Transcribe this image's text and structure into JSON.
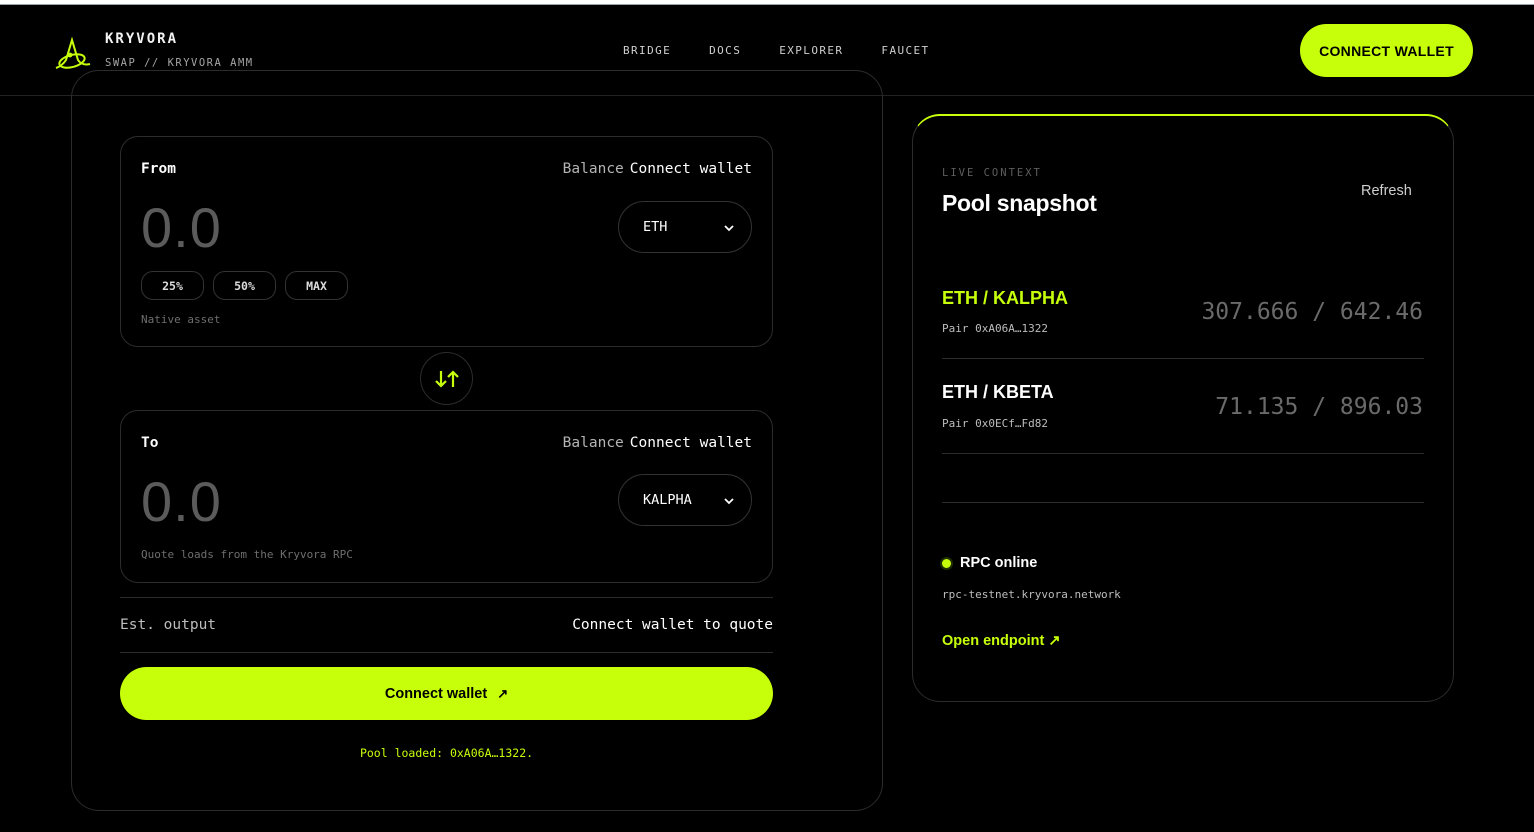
{
  "colors": {
    "accent": "#c7ff0b",
    "background": "#000000",
    "muted": "#5b5b5b"
  },
  "brand": {
    "title": "KRYVORA",
    "subtitle": "SWAP // KRYVORA AMM",
    "logo_icon": "kryvora-logo-icon"
  },
  "nav": {
    "items": [
      "BRIDGE",
      "DOCS",
      "EXPLORER",
      "FAUCET"
    ]
  },
  "header": {
    "connect_label": "CONNECT WALLET"
  },
  "from": {
    "label": "From",
    "balance_label": "Balance",
    "balance_value": "Connect wallet",
    "amount": "0.0",
    "token": "ETH",
    "percent_buttons": [
      "25%",
      "50%",
      "MAX"
    ],
    "hint": "Native asset"
  },
  "to": {
    "label": "To",
    "balance_label": "Balance",
    "balance_value": "Connect wallet",
    "amount": "0.0",
    "token": "KALPHA",
    "hint": "Quote loads from the Kryvora RPC"
  },
  "swap_toggle_icon": "swap-arrows-icon",
  "estimate": {
    "label": "Est. output",
    "value": "Connect wallet to quote"
  },
  "cta": {
    "label": "Connect wallet",
    "arrow": "↗"
  },
  "status_message": "Pool loaded: 0xA06A…1322.",
  "pool_panel": {
    "context_label": "LIVE CONTEXT",
    "title": "Pool snapshot",
    "refresh_label": "Refresh",
    "pairs": [
      {
        "name": "ETH / KALPHA",
        "address": "Pair 0xA06A…1322",
        "reserves": "307.666 / 642.46",
        "active": true
      },
      {
        "name": "ETH / KBETA",
        "address": "Pair 0x0ECf…Fd82",
        "reserves": "71.135 / 896.03",
        "active": false
      }
    ],
    "rpc": {
      "status": "RPC online",
      "url": "rpc-testnet.kryvora.network",
      "open_label": "Open endpoint ↗"
    }
  }
}
